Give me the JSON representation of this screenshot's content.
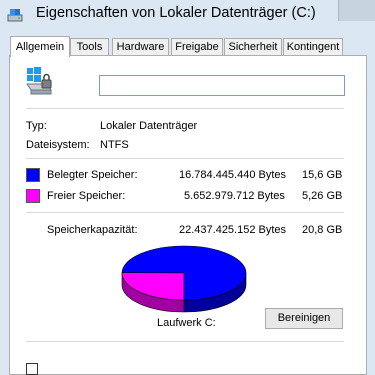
{
  "window": {
    "title": "Eigenschaften von Lokaler Datenträger (C:)"
  },
  "tabs": [
    "Allgemein",
    "Tools",
    "Hardware",
    "Freigabe",
    "Sicherheit",
    "Kontingent"
  ],
  "active_tab": "Allgemein",
  "drive": {
    "name_value": ""
  },
  "info": {
    "type_label": "Typ:",
    "type_value": "Lokaler Datenträger",
    "fs_label": "Dateisystem:",
    "fs_value": "NTFS"
  },
  "usage": {
    "used_label": "Belegter Speicher:",
    "used_bytes": "16.784.445.440 Bytes",
    "used_gb": "15,6 GB",
    "used_color": "#0000ff",
    "free_label": "Freier Speicher:",
    "free_bytes": "5.652.979.712 Bytes",
    "free_gb": "5,26 GB",
    "free_color": "#ff00ff",
    "capacity_label": "Speicherkapazität:",
    "capacity_bytes": "22.437.425.152 Bytes",
    "capacity_gb": "20,8 GB",
    "used_fraction": 0.748
  },
  "drive_label": "Laufwerk C:",
  "cleanup_button": "Bereinigen"
}
